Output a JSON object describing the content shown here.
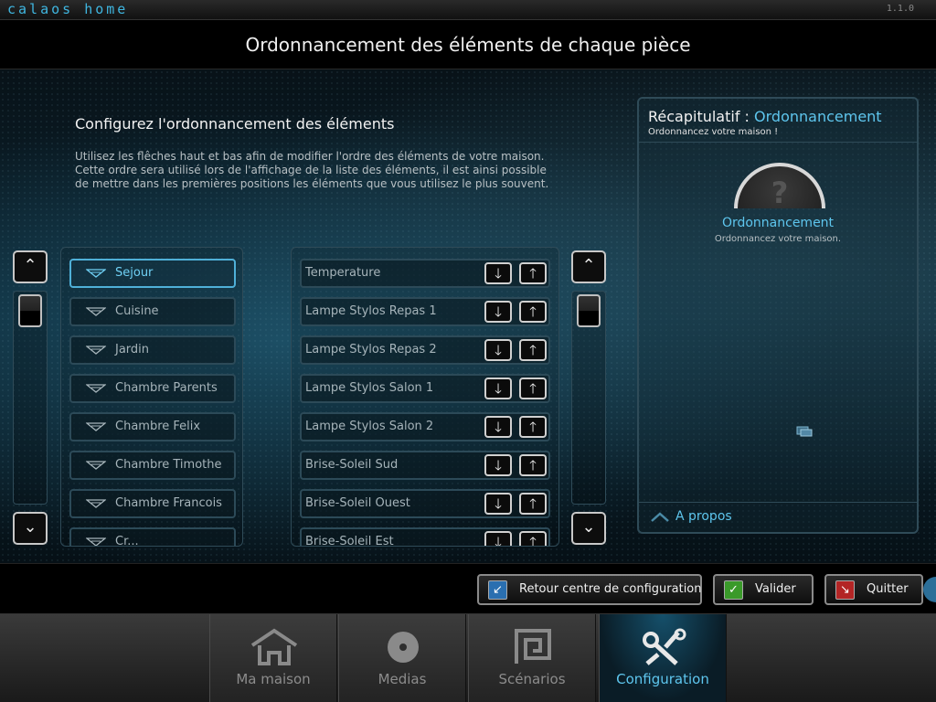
{
  "app": {
    "brand": "calaos home",
    "version": "1.1.0"
  },
  "page": {
    "title": "Ordonnancement des éléments de chaque pièce"
  },
  "config": {
    "heading": "Configurez l'ordonnancement des éléments",
    "description_lines": [
      "Utilisez les flêches haut et bas afin de modifier l'ordre des éléments de votre maison.",
      "Cette ordre sera utilisé lors de l'affichage de la liste des éléments, il est ainsi possible",
      "de mettre dans les premières positions les éléments que vous utilisez le plus souvent."
    ]
  },
  "rooms": {
    "selected_index": 0,
    "items": [
      "Sejour",
      "Cuisine",
      "Jardin",
      "Chambre Parents",
      "Chambre Felix",
      "Chambre Timothe",
      "Chambre Francois",
      "Cr..."
    ]
  },
  "elements": {
    "items": [
      "Temperature",
      "Lampe Stylos Repas 1",
      "Lampe Stylos Repas 2",
      "Lampe Stylos Salon 1",
      "Lampe Stylos Salon 2",
      "Brise-Soleil Sud",
      "Brise-Soleil Ouest",
      "Brise-Soleil Est"
    ],
    "down_glyph": "🡓",
    "up_glyph": "🡑"
  },
  "scroll": {
    "up_glyph": "⌃",
    "down_glyph": "⌄"
  },
  "recap": {
    "title_prefix": "Récapitulatif : ",
    "title_accent": "Ordonnancement",
    "subtitle": "Ordonnancez votre maison !",
    "dial_glyph": "?",
    "item_title": "Ordonnancement",
    "item_subtitle": "Ordonnancez votre maison.",
    "about_label": "A propos"
  },
  "actions": {
    "back_label": "Retour centre de configuration",
    "validate_label": "Valider",
    "quit_label": "Quitter",
    "back_icon": "↙",
    "validate_icon": "✓",
    "quit_icon": "↘"
  },
  "nav": {
    "tabs": [
      {
        "label": "Ma maison",
        "icon": "house-icon",
        "active": false
      },
      {
        "label": "Medias",
        "icon": "disc-icon",
        "active": false
      },
      {
        "label": "Scénarios",
        "icon": "spiral-icon",
        "active": false
      },
      {
        "label": "Configuration",
        "icon": "tools-icon",
        "active": true
      }
    ]
  },
  "colors": {
    "accent": "#5ec6ee",
    "validate_green": "#3a9a2a",
    "quit_red": "#b32525",
    "back_blue": "#2a6fb0"
  }
}
